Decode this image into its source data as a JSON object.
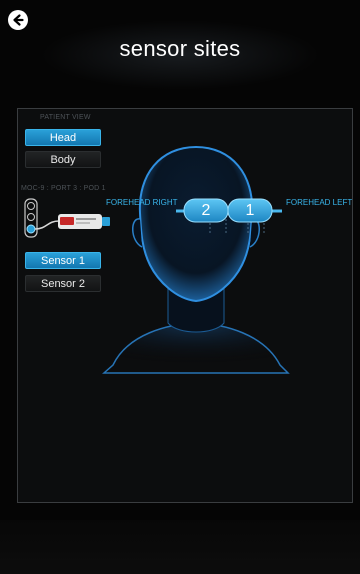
{
  "header": {
    "title": "sensor sites",
    "back_icon": "arrow-left-circle-icon"
  },
  "patient_view": {
    "label": "PATIENT VIEW",
    "options": [
      {
        "label": "Head",
        "selected": true
      },
      {
        "label": "Body",
        "selected": false
      }
    ]
  },
  "port": {
    "label": "MOC-9 : PORT 3 : POD 1",
    "active_slot": 3
  },
  "sensors": [
    {
      "label": "Sensor 1",
      "selected": true
    },
    {
      "label": "Sensor 2",
      "selected": false
    }
  ],
  "sites": {
    "right_label": "FOREHEAD RIGHT",
    "left_label": "FOREHEAD LEFT",
    "pad_2": "2",
    "pad_1": "1"
  },
  "colors": {
    "accent": "#2aa0d8",
    "accent_text": "#39b6ec",
    "background": "#050505"
  }
}
